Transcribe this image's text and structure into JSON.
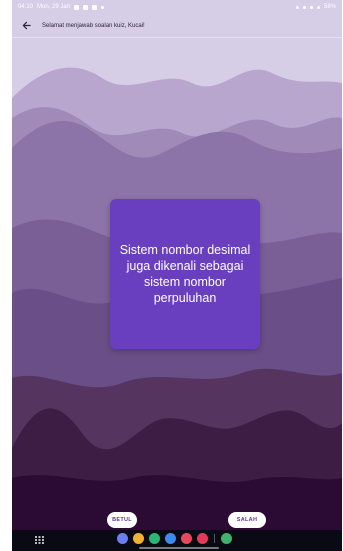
{
  "status": {
    "time": "04:10",
    "date": "Mon, 29 Jan",
    "battery": "58%"
  },
  "appbar": {
    "title": "Selamat menjawab soalan kuiz, Kucai!"
  },
  "card": {
    "text": "Sistem nombor desimal juga dikenali sebagai sistem nombor perpuluhan"
  },
  "buttons": {
    "true_label": "BETUL",
    "false_label": "SALAH"
  },
  "colors": {
    "card": "#6a3fbf",
    "bg_top": "#d6cde6",
    "bg_bottom": "#2b0a33"
  },
  "nav_apps": [
    "messages-icon",
    "notes-icon",
    "phone-icon",
    "chat-icon",
    "camera-icon",
    "video-icon",
    "store-icon"
  ]
}
